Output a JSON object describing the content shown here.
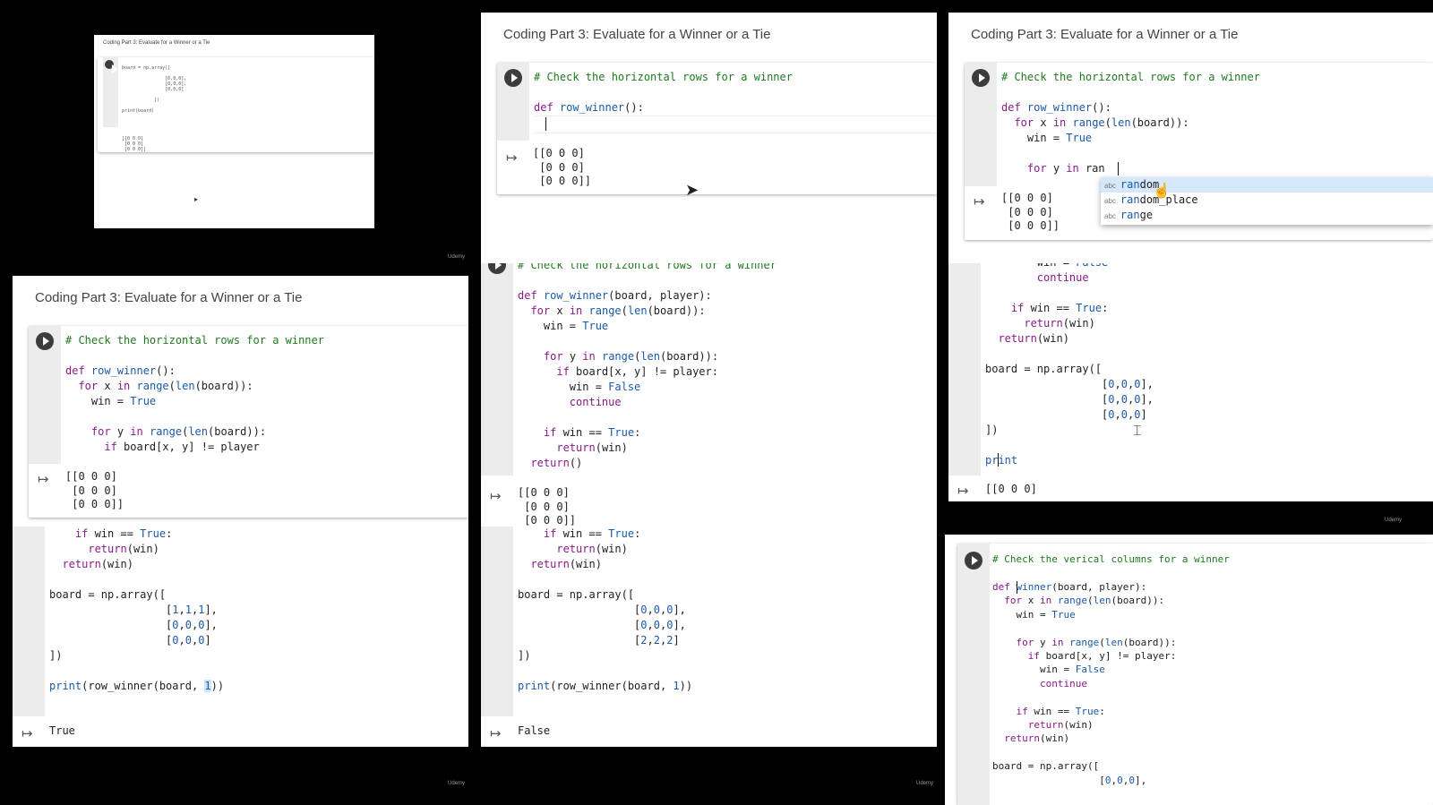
{
  "slide_title": "Coding Part 3: Evaluate for a Winner or a Tie",
  "watermark": "Udemy",
  "comment_rows": "# Check the horizontal rows for a winner",
  "comment_cols": "# Check the verical columns for a winner",
  "output_matrix_lines": [
    "[[0 0 0]",
    " [0 0 0]",
    " [0 0 0]]"
  ],
  "output_true": "True",
  "output_false": "False",
  "panel1": {
    "title": "Coding Part 3: Evaluate for a Winner or a Tie",
    "code": "board = np.array([\n\n                [0,0,0],\n                [0,0,0],\n                [0,0,0]\n\n            ])\n\nprint(board)",
    "output": "[[0 0 0]\n [0 0 0]\n [0 0 0]]"
  },
  "panel2": {
    "line_def": "def row_winner():"
  },
  "panel3": {
    "lines": [
      "def row_winner():",
      "  for x in range(len(board)):",
      "    win = True",
      "",
      "    for y in ran"
    ],
    "autocomplete": [
      {
        "type": "abc",
        "match": "ran",
        "rest": "dom"
      },
      {
        "type": "abc",
        "match": "ran",
        "rest": "dom_place"
      },
      {
        "type": "abc",
        "match": "ran",
        "rest": "ge"
      }
    ]
  },
  "panel4": {
    "lines": [
      "def row_winner():",
      "  for x in range(len(board)):",
      "    win = True",
      "",
      "    for y in range(len(board)):",
      "      if board[x, y] != player"
    ]
  },
  "panel5": {
    "lines": [
      "def row_winner(board, player):",
      "  for x in range(len(board)):",
      "    win = True",
      "",
      "    for y in range(len(board)):",
      "      if board[x, y] != player:",
      "        win = False",
      "        continue",
      "",
      "    if win == True:",
      "      return(win)",
      "  return()"
    ]
  },
  "panel6": {
    "lines": [
      "        win = False",
      "        continue",
      "",
      "    if win == True:",
      "      return(win)",
      "  return(win)",
      "",
      "board = np.array([",
      "                  [0,0,0],",
      "                  [0,0,0],",
      "                  [0,0,0]",
      "])",
      "",
      "print"
    ],
    "output_first": "[[0 0 0]"
  },
  "panel7": {
    "lines": [
      "    if win == True:",
      "      return(win)",
      "  return(win)",
      "",
      "board = np.array([",
      "                  [1,1,1],",
      "                  [0,0,0],",
      "                  [0,0,0]",
      "])",
      "",
      "print(row_winner(board, 1))"
    ]
  },
  "panel8": {
    "lines": [
      "    if win == True:",
      "      return(win)",
      "  return(win)",
      "",
      "board = np.array([",
      "                  [0,0,0],",
      "                  [0,0,0],",
      "                  [2,2,2]",
      "])",
      "",
      "print(row_winner(board, 1))"
    ]
  },
  "panel9": {
    "lines": [
      "def winner(board, player):",
      "  for x in range(len(board)):",
      "    win = True",
      "",
      "    for y in range(len(board)):",
      "      if board[x, y] != player:",
      "        win = False",
      "        continue",
      "",
      "    if win == True:",
      "      return(win)",
      "  return(win)",
      "",
      "board = np.array([",
      "                  [0,0,0],"
    ]
  },
  "colors": {
    "comment": "#1f7a1f",
    "keyword": "#8a1a8a",
    "builtin": "#1a5aa8",
    "background": "#000000"
  }
}
